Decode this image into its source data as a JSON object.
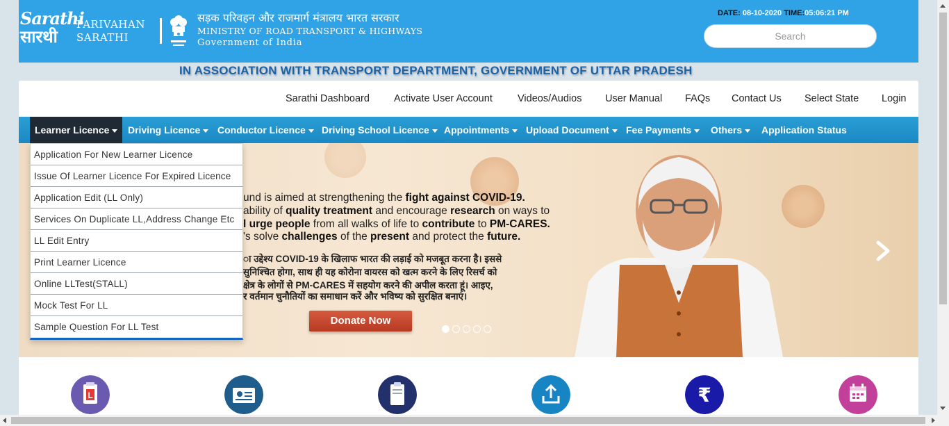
{
  "header": {
    "logo_top": "Sarathi",
    "logo_bottom": "सारथी",
    "brand_line1": "PARIVAHAN",
    "brand_line2": "SARATHI",
    "ministry_hindi": "सड़क परिवहन और राजमार्ग मंत्रालय भारत सरकार",
    "ministry_english": "MINISTRY OF ROAD TRANSPORT & HIGHWAYS",
    "government": "Government of India",
    "date_label": "DATE:",
    "date_value": "08-10-2020",
    "time_label": "TIME:",
    "time_value": "05:06:21 PM",
    "search_placeholder": "Search"
  },
  "association": "IN ASSOCIATION WITH TRANSPORT DEPARTMENT, GOVERNMENT OF UTTAR PRADESH",
  "topnav": [
    "Sarathi Dashboard",
    "Activate User Account",
    "Videos/Audios",
    "User Manual",
    "FAQs",
    "Contact Us",
    "Select State",
    "Login"
  ],
  "mainmenu": [
    "Learner Licence",
    "Driving Licence",
    "Conductor Licence",
    "Driving School Licence",
    "Appointments",
    "Upload Document",
    "Fee Payments",
    "Others",
    "Application Status"
  ],
  "dropdown": [
    "Application For New Learner Licence",
    "Issue Of Learner Licence For Expired Licence",
    "Application Edit (LL Only)",
    "Services On Duplicate LL,Address Change Etc",
    "LL Edit Entry",
    "Print Learner Licence",
    "Online LLTest(STALL)",
    "Mock Test For LL",
    "Sample Question For LL Test"
  ],
  "banner": {
    "en1_a": "und is aimed at strengthening the ",
    "en1_b": "fight against COVID-19.",
    "en2_a": "ability of ",
    "en2_b": "quality treatment",
    "en2_c": " and encourage ",
    "en2_d": "research",
    "en2_e": " on ways to",
    "en3_a": "l urge people",
    "en3_b": " from all walks of life to ",
    "en3_c": "contribute",
    "en3_d": " to ",
    "en3_e": "PM-CARES.",
    "en4_a": "'s solve ",
    "en4_b": "challenges",
    "en4_c": " of the ",
    "en4_d": "present",
    "en4_e": " and protect the ",
    "en4_f": "future.",
    "hi1": "ा उद्देश्य COVID-19 के खिलाफ भारत की लड़ाई को मजबूत करना है। इससे",
    "hi2": "सुनिश्चित होगा, साथ ही यह कोरोना वायरस को खत्म करने के लिए रिसर्च को",
    "hi3": "क्षेत्र के लोगों से PM-CARES में सहयोग करने की अपील करता हूं। आइए,",
    "hi4": "र वर्तमान चुनौतियों का समाधान करें और भविष्य को सुरक्षित बनाएं।",
    "donate": "Donate Now",
    "slide_count": 5,
    "active_slide": 1
  },
  "services": [
    {
      "icon": "learner-licence-icon",
      "color": "#6a5bb0"
    },
    {
      "icon": "driving-licence-card-icon",
      "color": "#1f5e8c"
    },
    {
      "icon": "clipboard-icon",
      "color": "#22306b"
    },
    {
      "icon": "upload-icon",
      "color": "#1784c4"
    },
    {
      "icon": "rupee-icon",
      "color": "#1a1aa8"
    },
    {
      "icon": "calendar-icon",
      "color": "#c2409a"
    }
  ]
}
